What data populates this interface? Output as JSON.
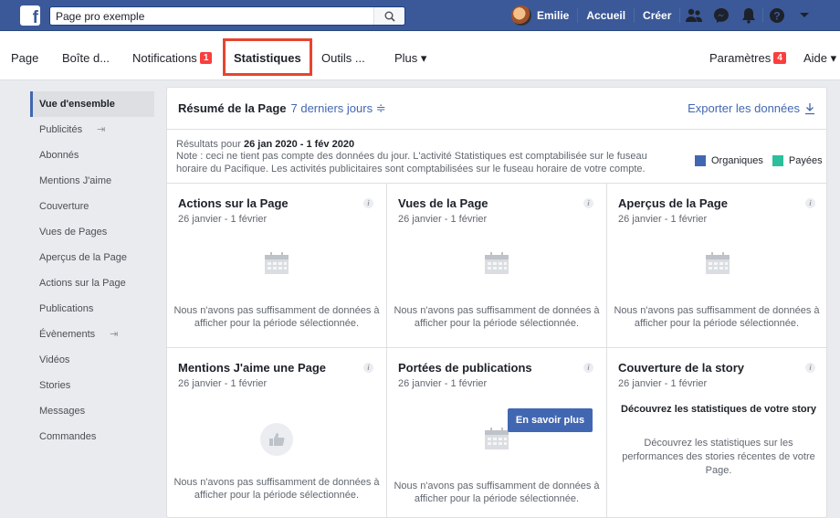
{
  "search": {
    "value": "Page pro exemple"
  },
  "topbar": {
    "user_name": "Emilie",
    "home": "Accueil",
    "create": "Créer"
  },
  "pagenav": {
    "page": "Page",
    "inbox": "Boîte d...",
    "notifications": "Notifications",
    "notifications_badge": "1",
    "insights": "Statistiques",
    "tools": "Outils ...",
    "more": "Plus ▾",
    "settings": "Paramètres",
    "settings_badge": "4",
    "help": "Aide ▾"
  },
  "sidebar": {
    "items": [
      {
        "label": "Vue d'ensemble",
        "active": true
      },
      {
        "label": "Publicités",
        "ext": true
      },
      {
        "label": "Abonnés"
      },
      {
        "label": "Mentions J'aime"
      },
      {
        "label": "Couverture"
      },
      {
        "label": "Vues de Pages"
      },
      {
        "label": "Aperçus de la Page"
      },
      {
        "label": "Actions sur la Page"
      },
      {
        "label": "Publications"
      },
      {
        "label": "Évènements",
        "ext": true
      },
      {
        "label": "Vidéos"
      },
      {
        "label": "Stories"
      },
      {
        "label": "Messages"
      },
      {
        "label": "Commandes"
      }
    ]
  },
  "summary": {
    "title": "Résumé de la Page",
    "period": "7 derniers jours ≑",
    "export": "Exporter les données",
    "results_prefix": "Résultats pour ",
    "results_range": "26 jan 2020 - 1 fév 2020",
    "note": "Note : ceci ne tient pas compte des données du jour. L'activité Statistiques est comptabilisée sur le fuseau horaire du Pacifique. Les activités publicitaires sont comptabilisées sur le fuseau horaire de votre compte.",
    "legend_organic": "Organiques",
    "legend_paid": "Payées",
    "color_organic": "#4267b2",
    "color_paid": "#2bbf9b"
  },
  "cards": [
    {
      "title": "Actions sur la Page",
      "range": "26 janvier - 1 février",
      "empty": "Nous n'avons pas suffisamment de données à afficher pour la période sélectionnée."
    },
    {
      "title": "Vues de la Page",
      "range": "26 janvier - 1 février",
      "empty": "Nous n'avons pas suffisamment de données à afficher pour la période sélectionnée."
    },
    {
      "title": "Aperçus de la Page",
      "range": "26 janvier - 1 février",
      "empty": "Nous n'avons pas suffisamment de données à afficher pour la période sélectionnée."
    },
    {
      "title": "Mentions J'aime une Page",
      "range": "26 janvier - 1 février",
      "empty": "Nous n'avons pas suffisamment de données à afficher pour la période sélectionnée."
    },
    {
      "title": "Portées de publications",
      "range": "26 janvier - 1 février",
      "empty": "Nous n'avons pas suffisamment de données à afficher pour la période sélectionnée."
    },
    {
      "title": "Couverture de la story",
      "range": "26 janvier - 1 février",
      "promo_title": "Découvrez les statistiques de votre story",
      "promo_text": "Découvrez les statistiques sur les performances des stories récentes de votre Page.",
      "promo_button": "En savoir plus"
    }
  ]
}
